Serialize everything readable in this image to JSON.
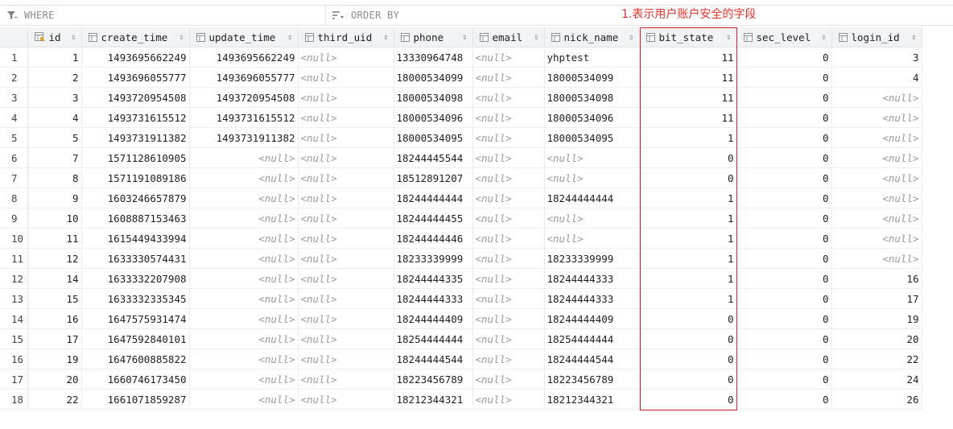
{
  "filters": {
    "where_label": "WHERE",
    "order_label": "ORDER BY"
  },
  "annotation": {
    "text": "1.表示用户账户安全的字段",
    "color": "#e0312b",
    "highlight_color": "#d8232a",
    "highlight_column": "bit_state"
  },
  "grid": {
    "columns": [
      {
        "key": "id",
        "label": "id",
        "icon": "primary-key-column-icon",
        "align": "num"
      },
      {
        "key": "create_time",
        "label": "create_time",
        "icon": "column-icon",
        "align": "num"
      },
      {
        "key": "update_time",
        "label": "update_time",
        "icon": "column-icon",
        "align": "num"
      },
      {
        "key": "third_uid",
        "label": "third_uid",
        "icon": "column-icon",
        "align": "txt"
      },
      {
        "key": "phone",
        "label": "phone",
        "icon": "column-icon",
        "align": "txt"
      },
      {
        "key": "email",
        "label": "email",
        "icon": "column-icon",
        "align": "txt"
      },
      {
        "key": "nick_name",
        "label": "nick_name",
        "icon": "column-icon",
        "align": "txt"
      },
      {
        "key": "bit_state",
        "label": "bit_state",
        "icon": "column-icon",
        "align": "num"
      },
      {
        "key": "sec_level",
        "label": "sec_level",
        "icon": "column-icon",
        "align": "num"
      },
      {
        "key": "login_id",
        "label": "login_id",
        "icon": "column-icon",
        "align": "num"
      }
    ],
    "null_text": "<null>",
    "rows": [
      [
        "1",
        "1",
        "1493695662249",
        "1493695662249",
        null,
        "13330964748",
        null,
        "yhptest",
        "11",
        "0",
        "3"
      ],
      [
        "2",
        "2",
        "1493696055777",
        "1493696055777",
        null,
        "18000534099",
        null,
        "18000534099",
        "11",
        "0",
        "4"
      ],
      [
        "3",
        "3",
        "1493720954508",
        "1493720954508",
        null,
        "18000534098",
        null,
        "18000534098",
        "11",
        "0",
        null
      ],
      [
        "4",
        "4",
        "1493731615512",
        "1493731615512",
        null,
        "18000534096",
        null,
        "18000534096",
        "11",
        "0",
        null
      ],
      [
        "5",
        "5",
        "1493731911382",
        "1493731911382",
        null,
        "18000534095",
        null,
        "18000534095",
        "1",
        "0",
        null
      ],
      [
        "6",
        "7",
        "1571128610905",
        null,
        null,
        "18244445544",
        null,
        null,
        "0",
        "0",
        null
      ],
      [
        "7",
        "8",
        "1571191089186",
        null,
        null,
        "18512891207",
        null,
        null,
        "0",
        "0",
        null
      ],
      [
        "8",
        "9",
        "1603246657879",
        null,
        null,
        "18244444444",
        null,
        "18244444444",
        "1",
        "0",
        null
      ],
      [
        "9",
        "10",
        "1608887153463",
        null,
        null,
        "18244444455",
        null,
        null,
        "1",
        "0",
        null
      ],
      [
        "10",
        "11",
        "1615449433994",
        null,
        null,
        "18244444446",
        null,
        null,
        "1",
        "0",
        null
      ],
      [
        "11",
        "12",
        "1633330574431",
        null,
        null,
        "18233339999",
        null,
        "18233339999",
        "1",
        "0",
        null
      ],
      [
        "12",
        "14",
        "1633332207908",
        null,
        null,
        "18244444335",
        null,
        "18244444333",
        "1",
        "0",
        "16"
      ],
      [
        "13",
        "15",
        "1633332335345",
        null,
        null,
        "18244444333",
        null,
        "18244444333",
        "1",
        "0",
        "17"
      ],
      [
        "14",
        "16",
        "1647575931474",
        null,
        null,
        "18244444409",
        null,
        "18244444409",
        "0",
        "0",
        "19"
      ],
      [
        "15",
        "17",
        "1647592840101",
        null,
        null,
        "18254444444",
        null,
        "18254444444",
        "0",
        "0",
        "20"
      ],
      [
        "16",
        "19",
        "1647600885822",
        null,
        null,
        "18244444544",
        null,
        "18244444544",
        "0",
        "0",
        "22"
      ],
      [
        "17",
        "20",
        "1660746173450",
        null,
        null,
        "18223456789",
        null,
        "18223456789",
        "0",
        "0",
        "24"
      ],
      [
        "18",
        "22",
        "1661071859287",
        null,
        null,
        "18212344321",
        null,
        "18212344321",
        "0",
        "0",
        "26"
      ]
    ]
  }
}
